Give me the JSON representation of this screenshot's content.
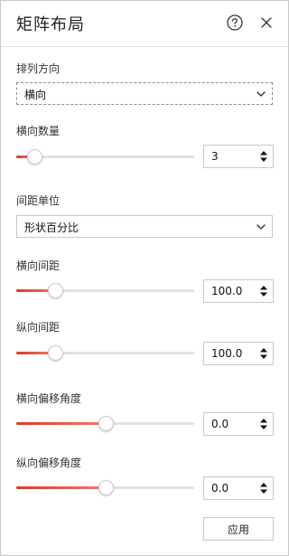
{
  "header": {
    "title": "矩阵布局"
  },
  "arrangement": {
    "label": "排列方向",
    "value": "横向"
  },
  "horizontal_count": {
    "label": "横向数量",
    "value": "3",
    "slider_fraction": 0.1
  },
  "spacing_unit": {
    "label": "间距单位",
    "value": "形状百分比"
  },
  "horizontal_spacing": {
    "label": "横向间距",
    "value": "100.0",
    "slider_fraction": 0.22
  },
  "vertical_spacing": {
    "label": "纵向间距",
    "value": "100.0",
    "slider_fraction": 0.22
  },
  "horizontal_offset_angle": {
    "label": "横向偏移角度",
    "value": "0.0",
    "slider_fraction": 0.5
  },
  "vertical_offset_angle": {
    "label": "纵向偏移角度",
    "value": "0.0",
    "slider_fraction": 0.5
  },
  "footer": {
    "apply_label": "应用"
  },
  "colors": {
    "accent": "#e0382b",
    "accent_light": "#f07a6e",
    "track": "#e1e1e1",
    "border": "#c8c8c8"
  },
  "icons": {
    "help": "help-circle-icon",
    "close": "close-icon",
    "dropdown": "chevron-down-icon",
    "spin_up": "triangle-up-icon",
    "spin_down": "triangle-down-icon"
  }
}
